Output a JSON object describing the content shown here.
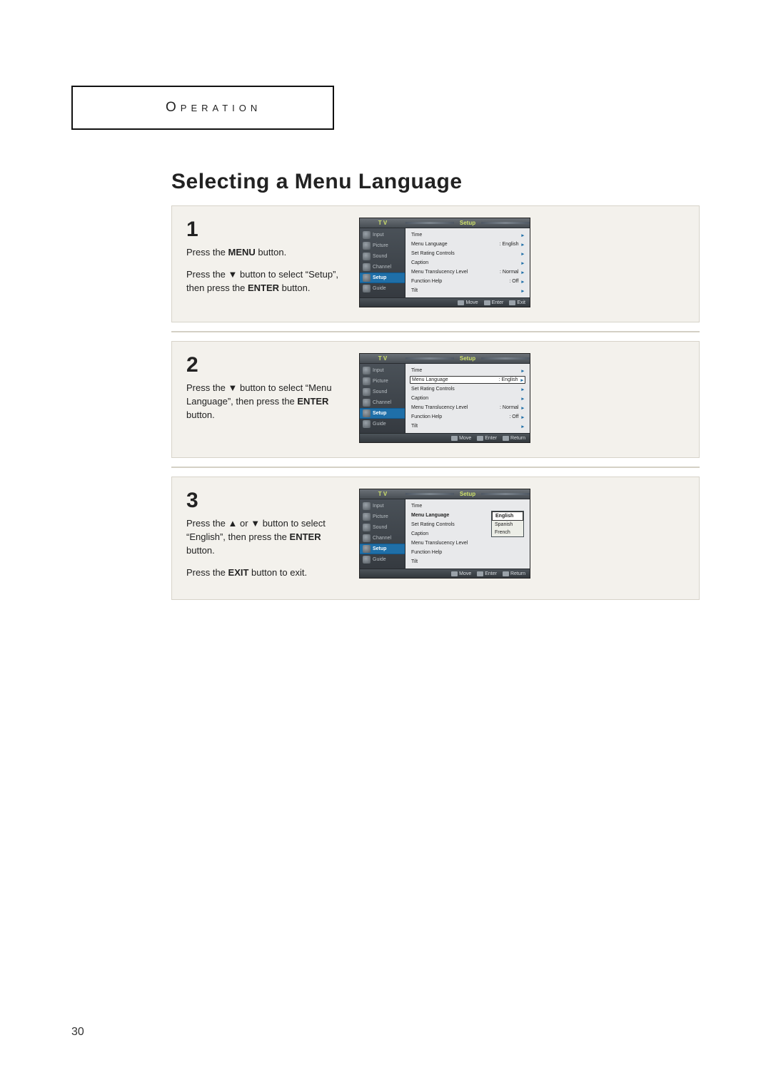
{
  "page": {
    "header_category": "Operation",
    "section_title": "Selecting a Menu Language",
    "page_number": "30"
  },
  "triangles": {
    "up": "▲",
    "down": "▼"
  },
  "steps": [
    {
      "num": "1",
      "text_pre": "Press the ",
      "bold": "MENU",
      "text_post": " button.",
      "p2_pre": "Press the ",
      "p2_tri": "▼",
      "p2_mid": " button to select “Setup”, then press the ",
      "p2_bold": "ENTER",
      "p2_post": " button."
    },
    {
      "num": "2",
      "p1_pre": "Press the ",
      "p1_tri": "▼",
      "p1_mid": " button to select “Menu Language”, then press the ",
      "p1_bold": "ENTER",
      "p1_post": " button."
    },
    {
      "num": "3",
      "p1_pre": "Press the ",
      "p1_tri1": "▲",
      "p1_or": " or ",
      "p1_tri2": "▼",
      "p1_mid": " button to select “English”, then press the ",
      "p1_bold": "ENTER",
      "p1_post": " button.",
      "p2_pre": "Press the ",
      "p2_bold": "EXIT",
      "p2_post": " button to exit."
    }
  ],
  "osd": {
    "tv": "T V",
    "category": "Setup",
    "tabs": [
      "Input",
      "Picture",
      "Sound",
      "Channel",
      "Setup",
      "Guide"
    ],
    "rows": [
      {
        "label": "Time",
        "value": ""
      },
      {
        "label": "Menu Language",
        "value": ": English"
      },
      {
        "label": "Set Rating Controls",
        "value": ""
      },
      {
        "label": "Caption",
        "value": ""
      },
      {
        "label": "Menu Translucency Level",
        "value": ": Normal"
      },
      {
        "label": "Function Help",
        "value": ": Off"
      },
      {
        "label": "Tilt",
        "value": ""
      }
    ],
    "rows3": [
      {
        "label": "Time"
      },
      {
        "label": "Menu Language"
      },
      {
        "label": "Set Rating Controls"
      },
      {
        "label": "Caption"
      },
      {
        "label": "Menu Translucency Level"
      },
      {
        "label": "Function Help"
      },
      {
        "label": "Tilt"
      }
    ],
    "footer": {
      "move": "Move",
      "enter": "Enter",
      "exit": "Exit",
      "ret": "Return"
    },
    "languages": [
      "English",
      "Spanish",
      "French"
    ]
  }
}
